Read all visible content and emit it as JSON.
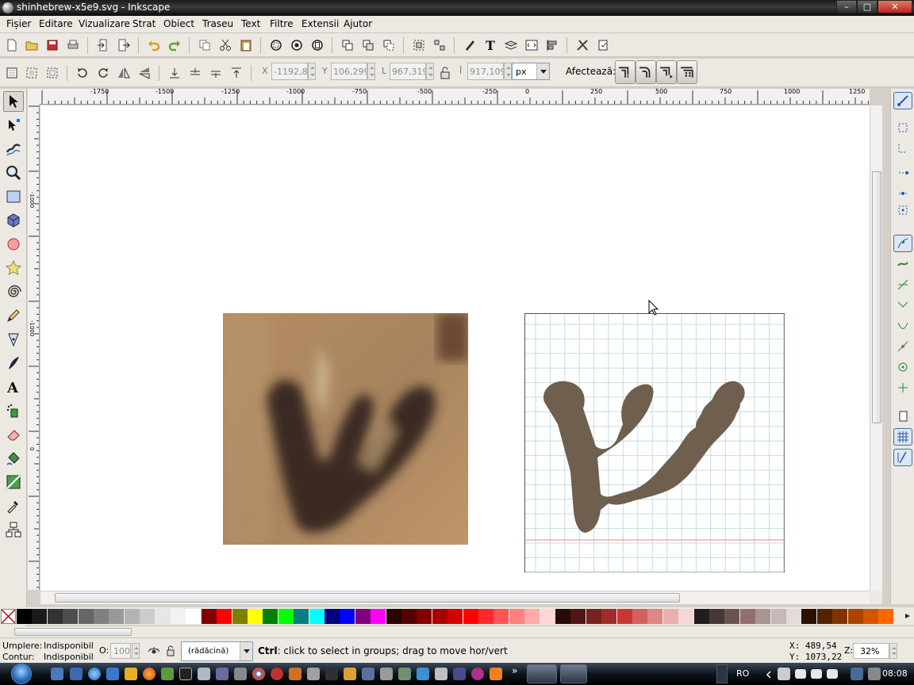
{
  "window": {
    "title": "shinhebrew-x5e9.svg - Inkscape",
    "min": "–",
    "max": "□",
    "close": "✕"
  },
  "menu": [
    "Fișier",
    "Editare",
    "Vizualizare",
    "Strat",
    "Obiect",
    "Traseu",
    "Text",
    "Filtre",
    "Extensii",
    "Ajutor"
  ],
  "toolbar": {
    "x_label": "X",
    "x_value": "-1192,8ı",
    "y_label": "Y",
    "y_value": "106,299",
    "w_label": "L",
    "w_value": "967,319",
    "h_label": "Î",
    "h_value": "917,109",
    "unit": "px",
    "affect_label": "Afectează:"
  },
  "ruler": {
    "h_ticks": [
      "-1750",
      "-1500",
      "-1250",
      "-1000",
      "-750",
      "-500",
      "-250",
      "0",
      "250",
      "500",
      "750",
      "1000",
      "1250"
    ],
    "v_ticks": [
      "-1000",
      "-1000",
      "0"
    ]
  },
  "status": {
    "fill_label": "Umplere:",
    "fill_value": "Indisponibil",
    "stroke_label": "Contur:",
    "stroke_value": "Indisponibil",
    "opacity_label": "O:",
    "opacity_value": "100",
    "layer": "(rădăcină)",
    "message_key": "Ctrl",
    "message": ": click to select in groups; drag to move hor/vert",
    "x_readout": "X:  489,54",
    "y_readout": "Y: 1073,22",
    "zoom_label": "Z:",
    "zoom": "32%"
  },
  "taskbar": {
    "lang": "RO",
    "clock": "08:08"
  },
  "palette": [
    "#000000",
    "#1a1a1a",
    "#333333",
    "#4d4d4d",
    "#666666",
    "#808080",
    "#999999",
    "#b3b3b3",
    "#cccccc",
    "#e6e6e6",
    "#f2f2f2",
    "#ffffff",
    "#800000",
    "#ff0000",
    "#808000",
    "#ffff00",
    "#008000",
    "#00ff00",
    "#008080",
    "#00ffff",
    "#000080",
    "#0000ff",
    "#800080",
    "#ff00ff",
    "#2b0000",
    "#550000",
    "#800000",
    "#aa0000",
    "#d40000",
    "#ff0000",
    "#ff2a2a",
    "#ff5555",
    "#ff8080",
    "#ffaaaa",
    "#ffd5d5",
    "#280b0b",
    "#501616",
    "#782121",
    "#a02c2c",
    "#c83737",
    "#d35f5f",
    "#de8787",
    "#e9afaf",
    "#f4d7d7",
    "#241c1c",
    "#483737",
    "#6c5353",
    "#916f6f",
    "#ac9393",
    "#c8b7b7",
    "#e3dbdb",
    "#2b1100",
    "#552200",
    "#803300",
    "#aa4400",
    "#d45500",
    "#ff6600"
  ],
  "colors": {
    "glyph": "#6f5f4e",
    "grid": "#c5dde0",
    "baseline": "#e08080"
  }
}
